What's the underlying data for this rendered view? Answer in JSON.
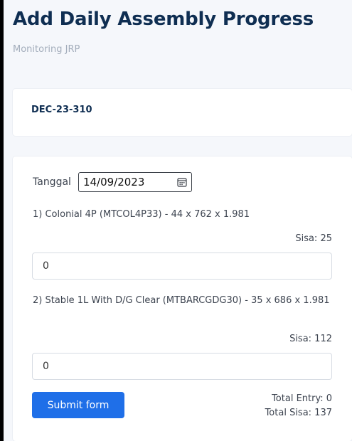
{
  "header": {
    "title": "Add Daily Assembly Progress",
    "subtitle": "Monitoring JRP"
  },
  "code_card": {
    "code": "DEC-23-310"
  },
  "form": {
    "date_label": "Tanggal",
    "date_value": "14/09/2023",
    "items": [
      {
        "label": "1) Colonial 4P (MTCOL4P33) - 44 x 762 x 1.981",
        "sisa": "Sisa: 25",
        "value": "0"
      },
      {
        "label": "2) Stable 1L With D/G Clear (MTBARCGDG30) - 35 x 686 x 1.981",
        "sisa": "Sisa: 112",
        "value": "0"
      }
    ],
    "submit_label": "Submit form",
    "total_entry": "Total Entry: 0",
    "total_sisa": "Total Sisa: 137"
  },
  "colors": {
    "title": "#0f2e52",
    "button": "#1f6fe8"
  }
}
